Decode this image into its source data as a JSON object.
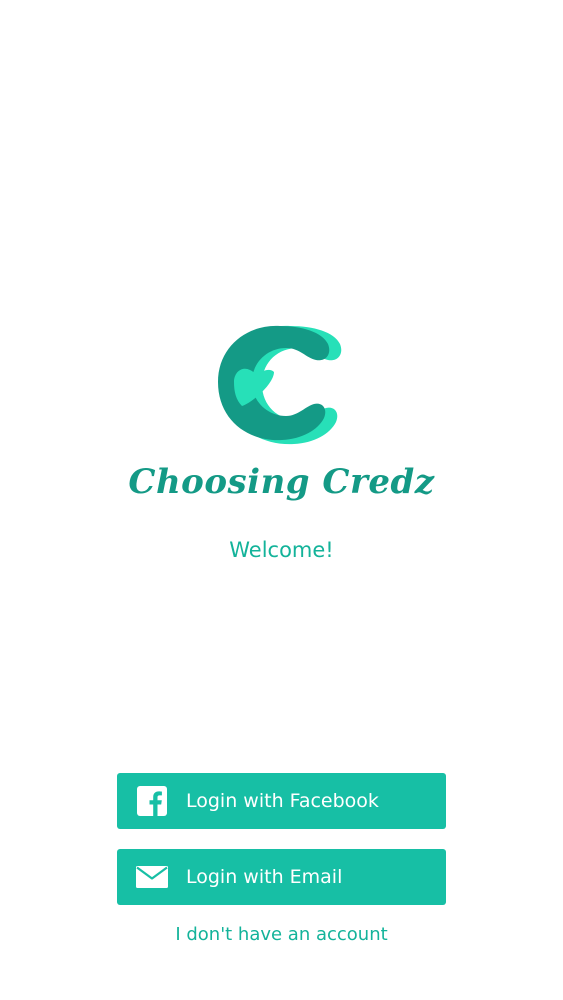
{
  "app": {
    "brand_name": "Choosing Credz",
    "logo_icon": "choosing-credz-c-logo",
    "colors": {
      "primary": "#17bfa5",
      "brand_dark": "#149a86",
      "logo_light": "#27e0b8",
      "text_on_primary": "#ffffff"
    }
  },
  "welcome_text": "Welcome!",
  "buttons": {
    "facebook": {
      "label": "Login with Facebook",
      "icon": "facebook-icon"
    },
    "email": {
      "label": "Login with Email",
      "icon": "mail-icon"
    }
  },
  "no_account_link": "I don't have an account"
}
